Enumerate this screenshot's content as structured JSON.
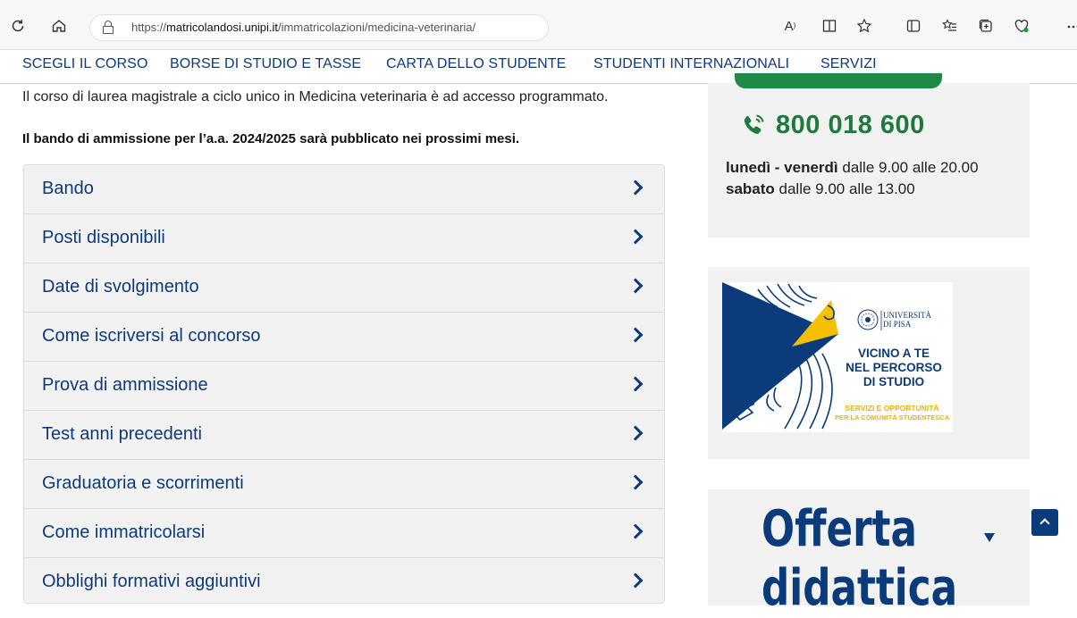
{
  "browser": {
    "url_prefix": "https://",
    "url_host": "matricolandosi.unipi.it",
    "url_path": "/immatricolazioni/medicina-veterinaria/",
    "read_aloud_label": "A",
    "icons": [
      "refresh-icon",
      "home-icon",
      "lock-icon",
      "read-aloud-icon",
      "reader-view-icon",
      "favorite-star-icon",
      "split-screen-icon",
      "favorites-list-icon",
      "collections-icon",
      "browser-essentials-icon",
      "more-icon"
    ]
  },
  "nav": {
    "items": [
      "SCEGLI IL CORSO",
      "BORSE DI STUDIO E TASSE",
      "CARTA DELLO STUDENTE",
      "STUDENTI INTERNAZIONALI",
      "SERVIZI"
    ]
  },
  "main": {
    "intro": "Il corso di laurea magistrale a ciclo unico in Medicina veterinaria è ad accesso programmato.",
    "notice": "Il bando di ammissione per l’a.a. 2024/2025 sarà pubblicato nei prossimi mesi.",
    "accordion": [
      "Bando",
      "Posti disponibili",
      "Date di svolgimento",
      "Come iscriversi al concorso",
      "Prova di ammissione",
      "Test anni precedenti",
      "Graduatoria e scorrimenti",
      "Come immatricolarsi",
      "Obblighi formativi aggiuntivi"
    ]
  },
  "sidebar": {
    "phone": "800 018 600",
    "hours_line1_bold": "lunedì - venerdì",
    "hours_line1_rest": " dalle 9.00 alle 20.00",
    "hours_line2_bold": "sabato",
    "hours_line2_rest": " dalle 9.00 alle 13.00",
    "banner": {
      "uni_line1": "UNIVERSITÀ",
      "uni_line2": "DI PISA",
      "title_line1": "VICINO A TE",
      "title_line2": "NEL PERCORSO",
      "title_line3": "DI STUDIO",
      "sub_line1": "SERVIZI E OPPORTUNITÀ",
      "sub_line2": "PER LA COMUNITÀ STUDENTESCA"
    },
    "offer_line1": "Offerta",
    "offer_line2": "didattica"
  },
  "colors": {
    "brand_blue": "#0b3b7a",
    "green": "#1f8a45",
    "yellow": "#f5c000"
  }
}
